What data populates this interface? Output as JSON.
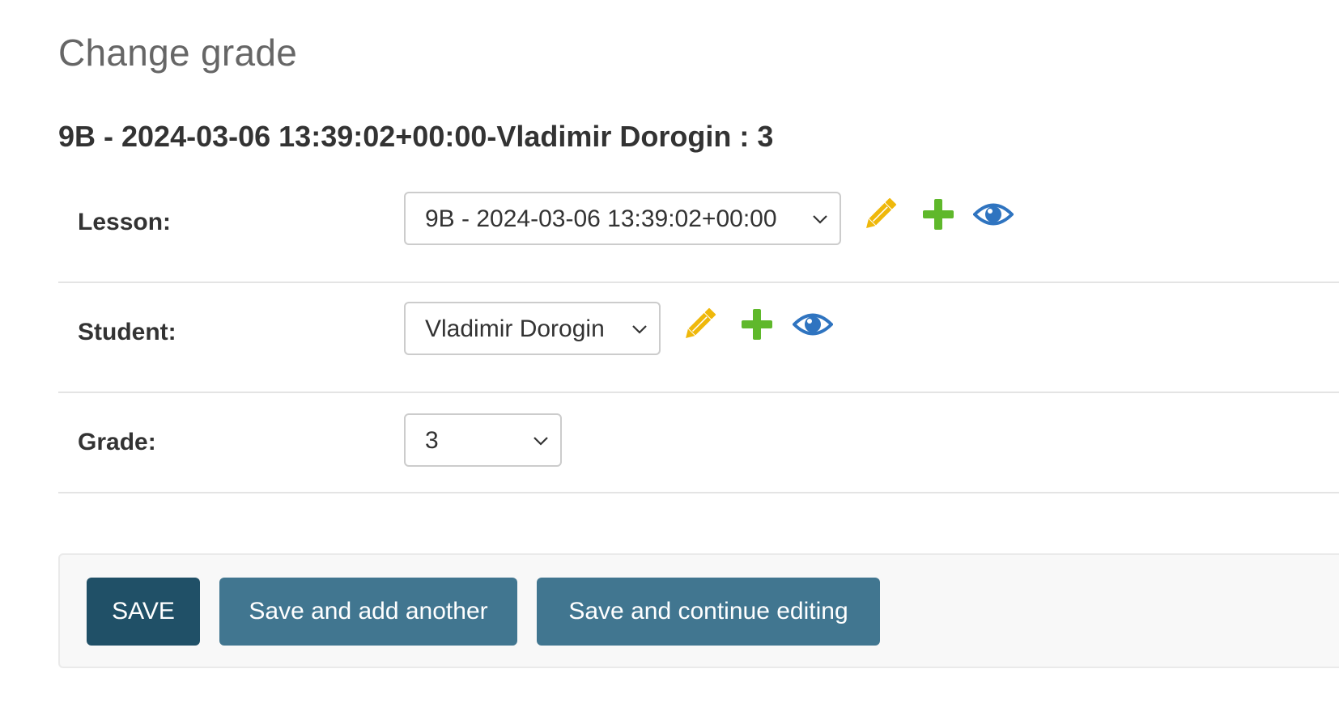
{
  "page": {
    "title": "Change grade",
    "object_title": "9B - 2024-03-06 13:39:02+00:00-Vladimir Dorogin : 3"
  },
  "form": {
    "lesson": {
      "label": "Lesson:",
      "selected": "9B - 2024-03-06 13:39:02+00:00"
    },
    "student": {
      "label": "Student:",
      "selected": "Vladimir Dorogin"
    },
    "grade": {
      "label": "Grade:",
      "selected": "3"
    }
  },
  "related_icons": {
    "edit": "pencil-icon",
    "add": "plus-icon",
    "view": "eye-icon",
    "edit_color": "#efb80b",
    "add_color": "#5fb82b",
    "view_color": "#2f74c0"
  },
  "submit": {
    "save_label": "SAVE",
    "save_add_label": "Save and add another",
    "save_continue_label": "Save and continue editing",
    "primary_color": "#205067",
    "secondary_color": "#417690"
  }
}
